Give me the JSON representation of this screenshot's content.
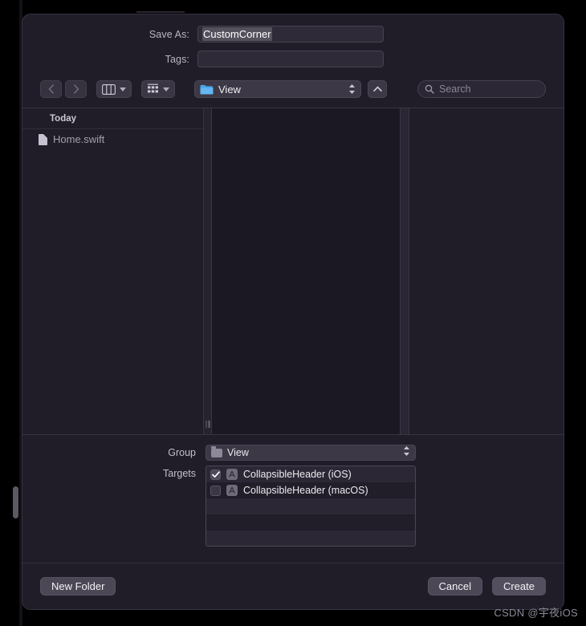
{
  "dialog": {
    "save_as_label": "Save As:",
    "save_as_value": "CustomCorner",
    "tags_label": "Tags:",
    "tags_value": ""
  },
  "toolbar": {
    "back_icon": "‹",
    "forward_icon": "›",
    "view_columns_icon": "columns-view-icon",
    "group_view_icon": "grid-view-icon",
    "path_popup_label": "View",
    "path_popup_icon": "blue-folder-icon",
    "up_button_icon": "^",
    "search_placeholder": "Search",
    "search_value": "",
    "search_icon": "search-icon"
  },
  "sidebar": {
    "section_header": "Today",
    "items": [
      {
        "label": "Home.swift",
        "icon": "document-icon"
      }
    ]
  },
  "meta": {
    "group_label": "Group",
    "group_value": "View",
    "targets_label": "Targets",
    "targets": [
      {
        "label": "CollapsibleHeader (iOS)",
        "checked": true,
        "icon": "app-icon"
      },
      {
        "label": "CollapsibleHeader (macOS)",
        "checked": false,
        "icon": "app-icon"
      }
    ]
  },
  "footer": {
    "new_folder_label": "New Folder",
    "cancel_label": "Cancel",
    "create_label": "Create"
  },
  "watermark": {
    "text": "CSDN @宇夜iOS"
  },
  "colors": {
    "window_bg": "#201c28",
    "panel_bg": "#1c1823",
    "control_bg": "#3c3845",
    "accent_folder": "#4aa3e8",
    "text_primary": "#f0eef4",
    "text_secondary": "#a3a0ac"
  }
}
